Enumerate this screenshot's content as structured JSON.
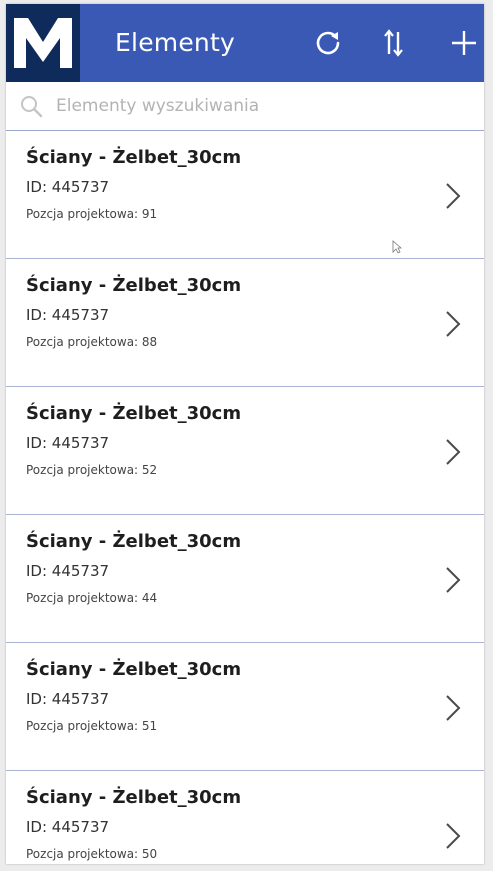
{
  "header": {
    "title": "Elementy",
    "logo_icon": "m-logo-icon",
    "refresh_icon": "refresh-icon",
    "sort_icon": "sort-icon",
    "add_icon": "plus-icon",
    "bg_color": "#3a59b5",
    "logo_bg_color": "#0f2b5c"
  },
  "search": {
    "placeholder": "Elementy wyszukiwania",
    "value": "",
    "icon": "search-icon"
  },
  "list": {
    "items": [
      {
        "title": "Ściany - Żelbet_30cm",
        "id": "ID: 445737",
        "position": "Pozcja projektowa: 91"
      },
      {
        "title": "Ściany - Żelbet_30cm",
        "id": "ID: 445737",
        "position": "Pozcja projektowa: 88"
      },
      {
        "title": "Ściany - Żelbet_30cm",
        "id": "ID: 445737",
        "position": "Pozcja projektowa: 52"
      },
      {
        "title": "Ściany - Żelbet_30cm",
        "id": "ID: 445737",
        "position": "Pozcja projektowa: 44"
      },
      {
        "title": "Ściany - Żelbet_30cm",
        "id": "ID: 445737",
        "position": "Pozcja projektowa: 51"
      },
      {
        "title": "Ściany - Żelbet_30cm",
        "id": "ID: 445737",
        "position": "Pozcja projektowa: 50"
      }
    ],
    "chevron_icon": "chevron-right-icon",
    "divider_color": "#a9b3d3"
  }
}
